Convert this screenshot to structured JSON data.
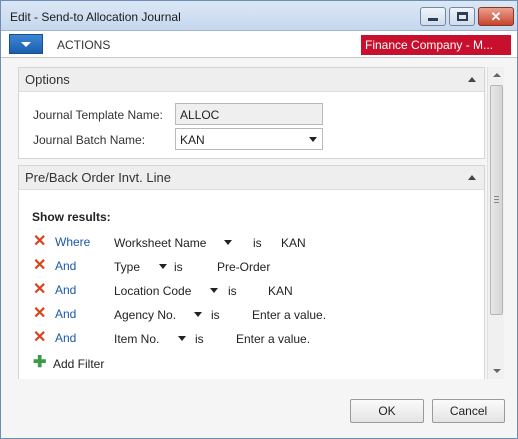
{
  "window": {
    "title": "Edit - Send-to Allocation Journal"
  },
  "actions": {
    "label": "ACTIONS",
    "company": "Finance Company - M..."
  },
  "options": {
    "header": "Options",
    "template_label": "Journal Template Name:",
    "template_value": "ALLOC",
    "batch_label": "Journal Batch Name:",
    "batch_value": "KAN"
  },
  "filters": {
    "header": "Pre/Back Order Invt. Line",
    "show_results": "Show results:",
    "rows": [
      {
        "connector": "Where",
        "field": "Worksheet Name",
        "op": "is",
        "value": "KAN"
      },
      {
        "connector": "And",
        "field": "Type",
        "op": "is",
        "value": "Pre-Order"
      },
      {
        "connector": "And",
        "field": "Location Code",
        "op": "is",
        "value": "KAN"
      },
      {
        "connector": "And",
        "field": "Agency No.",
        "op": "is",
        "value": "Enter a value."
      },
      {
        "connector": "And",
        "field": "Item No.",
        "op": "is",
        "value": "Enter a value."
      }
    ],
    "add_filter": "Add Filter"
  },
  "buttons": {
    "ok": "OK",
    "cancel": "Cancel"
  },
  "colors": {
    "company_badge": "#c8102e",
    "remove_icon": "#d9431c",
    "connector": "#1a56a8",
    "add_icon": "#3d9b46"
  }
}
